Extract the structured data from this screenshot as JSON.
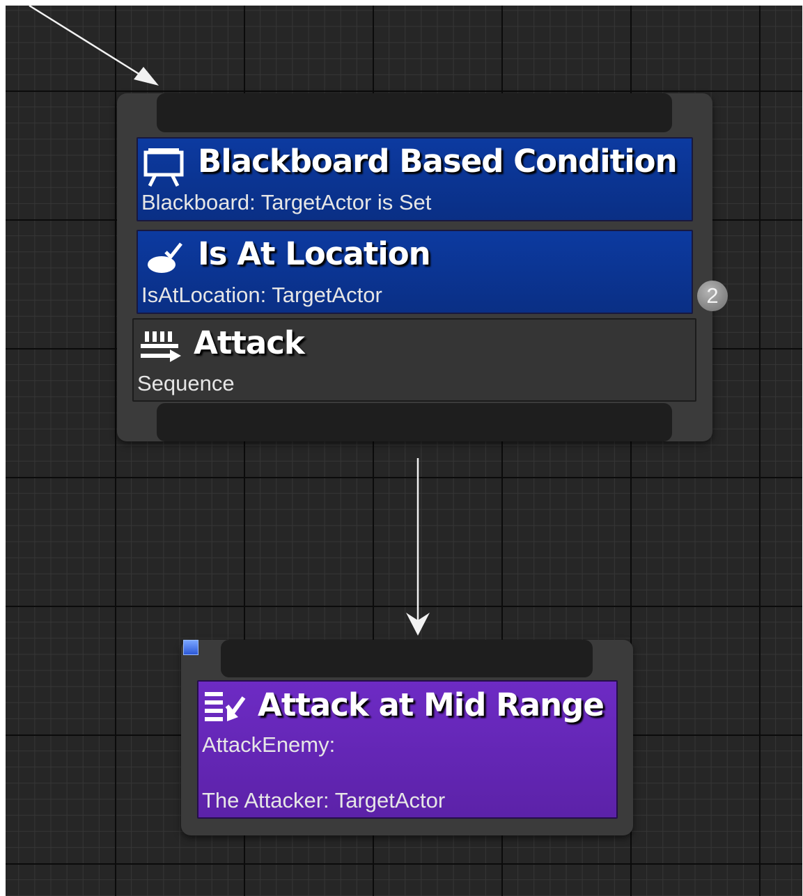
{
  "canvas": {
    "grid_colors": {
      "major": "#0b0b0b",
      "minor": "#363636",
      "background": "#262626"
    }
  },
  "composite_node": {
    "decorators": [
      {
        "icon": "blackboard-icon",
        "title": "Blackboard Based Condition",
        "subtitle": "Blackboard: TargetActor is Set",
        "color": "#0c3aa0"
      },
      {
        "icon": "location-check-icon",
        "title": "Is At Location",
        "subtitle": "IsAtLocation: TargetActor",
        "color": "#0c3aa0"
      }
    ],
    "composite": {
      "icon": "sequence-icon",
      "title": "Attack",
      "subtitle": "Sequence",
      "color": "#353535"
    },
    "execution_index": "2"
  },
  "task_node": {
    "icon": "task-icon",
    "title": "Attack at Mid Range",
    "subtitle_line1": "AttackEnemy:",
    "subtitle_line2": "The Attacker: TargetActor",
    "color": "#6d2bc4"
  }
}
